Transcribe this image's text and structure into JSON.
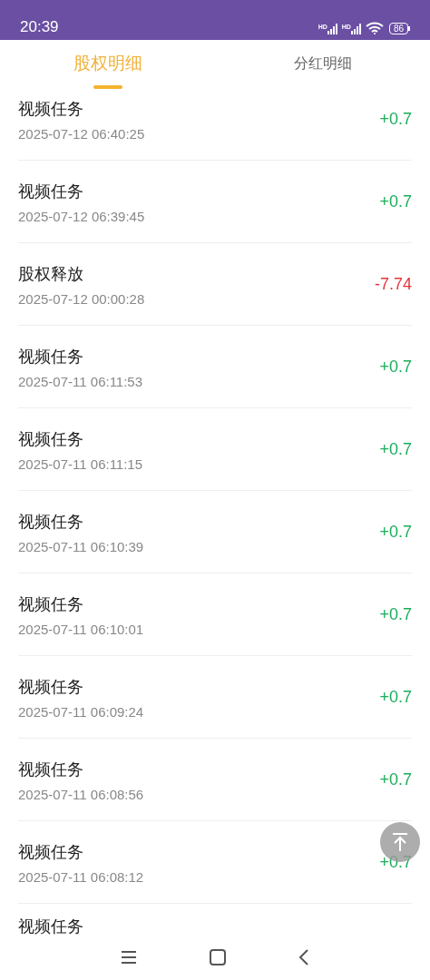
{
  "status_bar": {
    "time": "20:39",
    "signal_labels": [
      "HD",
      "HD"
    ],
    "battery": "86"
  },
  "tabs": [
    {
      "label": "股权明细",
      "selected": true
    },
    {
      "label": "分红明细",
      "selected": false
    }
  ],
  "records": [
    {
      "title": "视频任务",
      "time": "2025-07-12 06:40:25",
      "amount": "+0.7",
      "kind": "gain"
    },
    {
      "title": "视频任务",
      "time": "2025-07-12 06:39:45",
      "amount": "+0.7",
      "kind": "gain"
    },
    {
      "title": "股权释放",
      "time": "2025-07-12 00:00:28",
      "amount": "-7.74",
      "kind": "loss"
    },
    {
      "title": "视频任务",
      "time": "2025-07-11 06:11:53",
      "amount": "+0.7",
      "kind": "gain"
    },
    {
      "title": "视频任务",
      "time": "2025-07-11 06:11:15",
      "amount": "+0.7",
      "kind": "gain"
    },
    {
      "title": "视频任务",
      "time": "2025-07-11 06:10:39",
      "amount": "+0.7",
      "kind": "gain"
    },
    {
      "title": "视频任务",
      "time": "2025-07-11 06:10:01",
      "amount": "+0.7",
      "kind": "gain"
    },
    {
      "title": "视频任务",
      "time": "2025-07-11 06:09:24",
      "amount": "+0.7",
      "kind": "gain"
    },
    {
      "title": "视频任务",
      "time": "2025-07-11 06:08:56",
      "amount": "+0.7",
      "kind": "gain"
    },
    {
      "title": "视频任务",
      "time": "2025-07-11 06:08:12",
      "amount": "+0.7",
      "kind": "gain"
    },
    {
      "title": "视频任务"
    }
  ]
}
